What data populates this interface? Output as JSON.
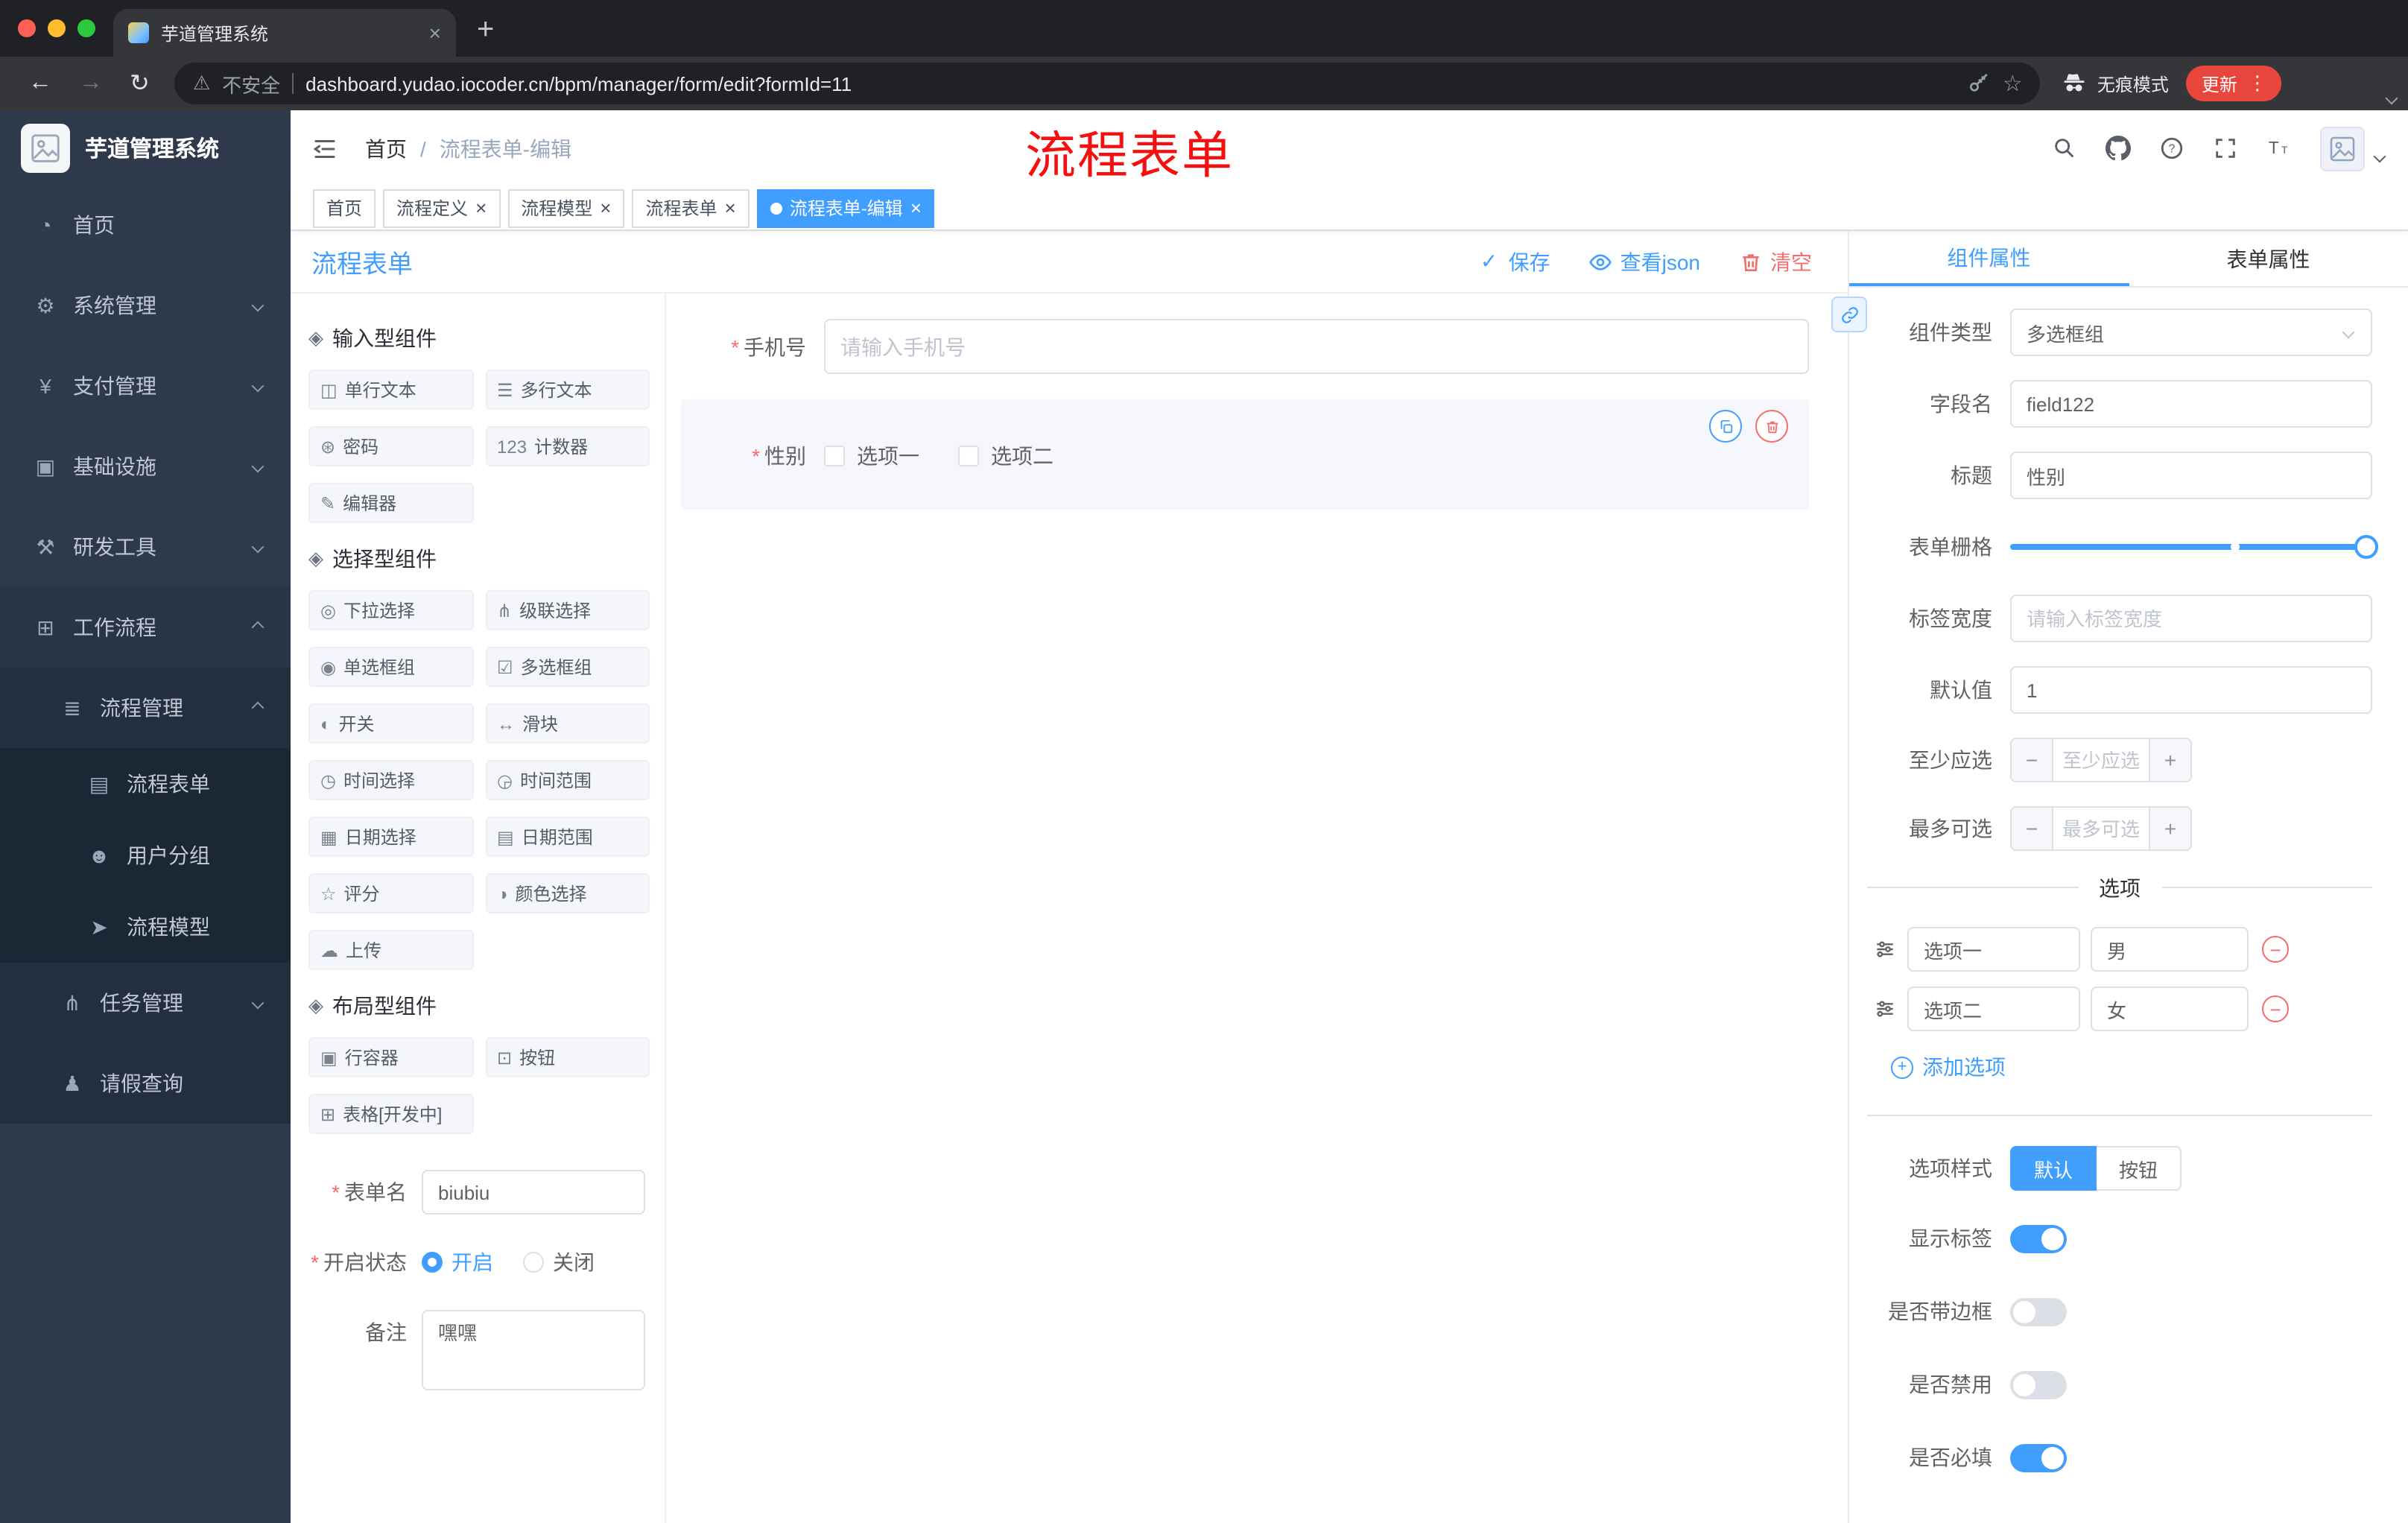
{
  "browser": {
    "tab_title": "芋道管理系统",
    "security_label": "不安全",
    "url": "dashboard.yudao.iocoder.cn/bpm/manager/form/edit?formId=11",
    "incognito_label": "无痕模式",
    "update_label": "更新"
  },
  "annotation_text": "流程表单",
  "colors": {
    "accent": "#409eff",
    "danger": "#f56c6c",
    "annotation": "#f50f0f",
    "sidebar_bg": "#2e3a4b"
  },
  "sidebar": {
    "logo_title": "芋道管理系统",
    "items": [
      {
        "name": "home",
        "label": "首页",
        "icon": "dashboard-icon",
        "level": 1
      },
      {
        "name": "system-management",
        "label": "系统管理",
        "icon": "gear-icon",
        "level": 1,
        "chevron": "down"
      },
      {
        "name": "payment-management",
        "label": "支付管理",
        "icon": "yen-icon",
        "level": 1,
        "chevron": "down"
      },
      {
        "name": "infrastructure",
        "label": "基础设施",
        "icon": "monitor-icon",
        "level": 1,
        "chevron": "down"
      },
      {
        "name": "dev-tools",
        "label": "研发工具",
        "icon": "tools-icon",
        "level": 1,
        "chevron": "down"
      },
      {
        "name": "workflow",
        "label": "工作流程",
        "icon": "workflow-icon",
        "level": 1,
        "chevron": "up",
        "expanded": true
      },
      {
        "name": "process-management",
        "label": "流程管理",
        "icon": "list-icon",
        "level": 2,
        "chevron": "up",
        "expanded": true
      },
      {
        "name": "process-form",
        "label": "流程表单",
        "icon": "form-icon",
        "level": 3
      },
      {
        "name": "user-group",
        "label": "用户分组",
        "icon": "users-icon",
        "level": 3
      },
      {
        "name": "process-model",
        "label": "流程模型",
        "icon": "send-icon",
        "level": 3
      },
      {
        "name": "task-management",
        "label": "任务管理",
        "icon": "branch-icon",
        "level": 2,
        "chevron": "down"
      },
      {
        "name": "leave-query",
        "label": "请假查询",
        "icon": "user-icon",
        "level": 2
      }
    ]
  },
  "header": {
    "breadcrumb": [
      "首页",
      "流程表单-编辑"
    ],
    "icons": [
      "search-icon",
      "github-icon",
      "help-icon",
      "fullscreen-icon",
      "font-size-icon"
    ]
  },
  "tabbar": [
    {
      "name": "home",
      "label": "首页",
      "closable": false,
      "active": false
    },
    {
      "name": "process-definition",
      "label": "流程定义",
      "closable": true,
      "active": false
    },
    {
      "name": "process-model",
      "label": "流程模型",
      "closable": true,
      "active": false
    },
    {
      "name": "process-form",
      "label": "流程表单",
      "closable": true,
      "active": false
    },
    {
      "name": "process-form-edit",
      "label": "流程表单-编辑",
      "closable": true,
      "active": true
    }
  ],
  "designer": {
    "title": "流程表单",
    "actions": [
      {
        "name": "save-button",
        "label": "保存",
        "icon": "check-icon",
        "type": "primary"
      },
      {
        "name": "view-json-button",
        "label": "查看json",
        "icon": "eye-icon",
        "type": "primary"
      },
      {
        "name": "clear-button",
        "label": "清空",
        "icon": "trash-icon",
        "type": "danger"
      }
    ],
    "palette_groups": [
      {
        "title": "输入型组件",
        "items": [
          {
            "name": "input-text",
            "label": "单行文本",
            "icon": "input-icon"
          },
          {
            "name": "textarea",
            "label": "多行文本",
            "icon": "textarea-icon"
          },
          {
            "name": "password",
            "label": "密码",
            "icon": "lock-icon"
          },
          {
            "name": "counter",
            "label": "计数器",
            "icon": "counter-icon"
          },
          {
            "name": "editor",
            "label": "编辑器",
            "icon": "editor-icon"
          }
        ]
      },
      {
        "title": "选择型组件",
        "items": [
          {
            "name": "select",
            "label": "下拉选择",
            "icon": "select-icon"
          },
          {
            "name": "cascader",
            "label": "级联选择",
            "icon": "cascader-icon"
          },
          {
            "name": "radio-group",
            "label": "单选框组",
            "icon": "radio-icon"
          },
          {
            "name": "checkbox-group",
            "label": "多选框组",
            "icon": "checkbox-icon"
          },
          {
            "name": "switch",
            "label": "开关",
            "icon": "switch-icon"
          },
          {
            "name": "slider",
            "label": "滑块",
            "icon": "slider-icon"
          },
          {
            "name": "time-picker",
            "label": "时间选择",
            "icon": "time-icon"
          },
          {
            "name": "time-range",
            "label": "时间范围",
            "icon": "time-range-icon"
          },
          {
            "name": "date-picker",
            "label": "日期选择",
            "icon": "date-icon"
          },
          {
            "name": "date-range",
            "label": "日期范围",
            "icon": "date-range-icon"
          },
          {
            "name": "rate",
            "label": "评分",
            "icon": "rate-icon"
          },
          {
            "name": "color-picker",
            "label": "颜色选择",
            "icon": "color-icon"
          },
          {
            "name": "upload",
            "label": "上传",
            "icon": "upload-icon"
          }
        ]
      },
      {
        "title": "布局型组件",
        "items": [
          {
            "name": "row-container",
            "label": "行容器",
            "icon": "row-icon"
          },
          {
            "name": "button",
            "label": "按钮",
            "icon": "button-icon"
          },
          {
            "name": "table",
            "label": "表格[开发中]",
            "icon": "table-icon"
          }
        ]
      }
    ],
    "meta": {
      "name_label": "表单名",
      "name_value": "biubiu",
      "status_label": "开启状态",
      "status_on": "开启",
      "status_off": "关闭",
      "status_selected": "开启",
      "remark_label": "备注",
      "remark_value": "嘿嘿"
    },
    "canvas": {
      "phone": {
        "label": "手机号",
        "required": true,
        "placeholder": "请输入手机号"
      },
      "gender": {
        "label": "性别",
        "required": true,
        "options": [
          "选项一",
          "选项二"
        ]
      }
    }
  },
  "props": {
    "tabs": [
      "组件属性",
      "表单属性"
    ],
    "active_tab": "组件属性",
    "component_type_label": "组件类型",
    "component_type_value": "多选框组",
    "field_name_label": "字段名",
    "field_name_value": "field122",
    "title_label": "标题",
    "title_value": "性别",
    "grid_label": "表单栅格",
    "tag_width_label": "标签宽度",
    "tag_width_placeholder": "请输入标签宽度",
    "default_label": "默认值",
    "default_value": "1",
    "min_label": "至少应选",
    "min_placeholder": "至少应选",
    "max_label": "最多可选",
    "max_placeholder": "最多可选",
    "options_title": "选项",
    "options": [
      {
        "name": "option-1",
        "label": "选项一",
        "value": "男"
      },
      {
        "name": "option-2",
        "label": "选项二",
        "value": "女"
      }
    ],
    "add_option_label": "添加选项",
    "style_label": "选项样式",
    "style_options": [
      "默认",
      "按钮"
    ],
    "style_selected": "默认",
    "switches": [
      {
        "name": "show-label",
        "label": "显示标签",
        "on": true
      },
      {
        "name": "with-border",
        "label": "是否带边框",
        "on": false
      },
      {
        "name": "disabled",
        "label": "是否禁用",
        "on": false
      },
      {
        "name": "required",
        "label": "是否必填",
        "on": true
      }
    ]
  }
}
